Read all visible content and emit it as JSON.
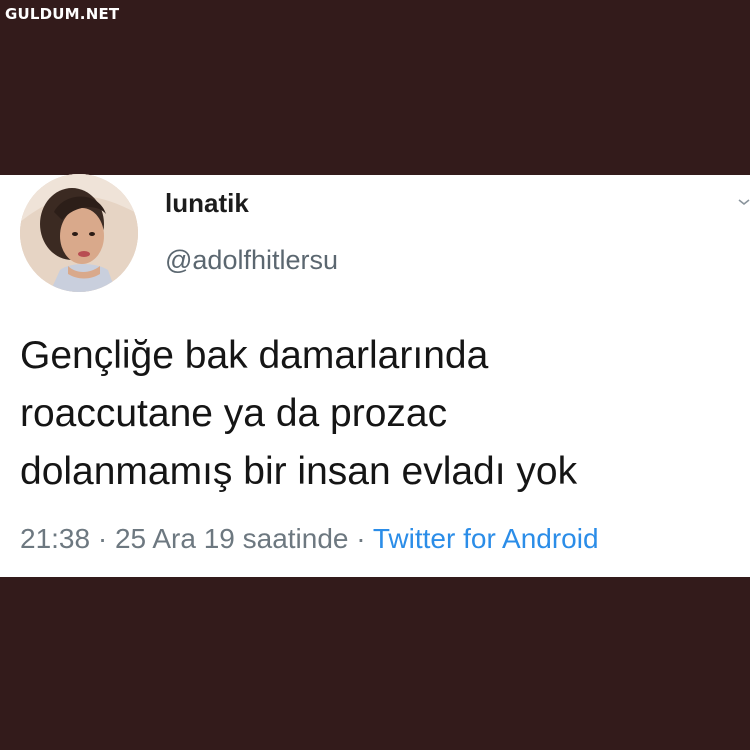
{
  "watermark": "GULDUM.NET",
  "tweet": {
    "display_name": "lunatik",
    "handle": "@adolfhitlersu",
    "text_lines": [
      "Gençliğe bak damarlarında",
      "roaccutane ya da prozac",
      "dolanmamış bir insan evladı yok"
    ],
    "time": "21:38",
    "date": "25 Ara 19 saatinde",
    "separator": " · ",
    "source": "Twitter for Android"
  },
  "icons": {
    "avatar": "profile-photo",
    "menu": "chevron-down-icon"
  },
  "colors": {
    "background": "#331b1b",
    "card": "#ffffff",
    "link": "#2b8de8",
    "meta_text": "#6d7880"
  }
}
